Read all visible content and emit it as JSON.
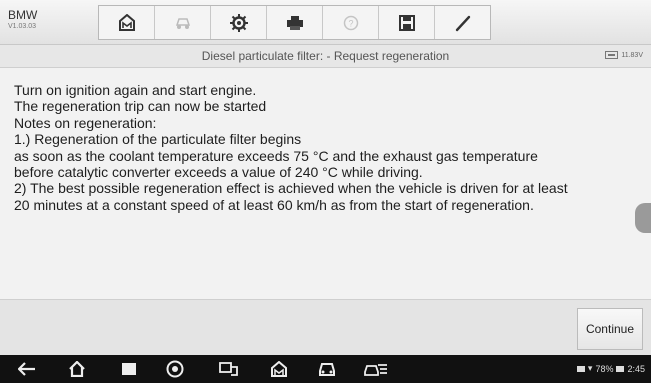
{
  "app": {
    "brand": "BMW",
    "version": "V1.03.03"
  },
  "toolbar": {
    "buttons": [
      {
        "icon": "home-icon"
      },
      {
        "icon": "car-icon"
      },
      {
        "icon": "gear-icon"
      },
      {
        "icon": "printer-icon"
      },
      {
        "icon": "help-icon"
      },
      {
        "icon": "save-icon"
      },
      {
        "icon": "pen-icon"
      }
    ]
  },
  "header": {
    "title": "Diesel particulate filter: - Request regeneration",
    "voltage": "11.83V"
  },
  "message": {
    "lines": [
      "Turn on ignition again and start engine.",
      "The regeneration trip can now be started",
      "Notes on regeneration:",
      "1.) Regeneration of the particulate filter begins",
      "as soon as the coolant temperature exceeds 75 °C and the exhaust gas temperature",
      "before catalytic converter exceeds a value of 240 °C while driving.",
      "2) The best possible regeneration effect is achieved when the vehicle is driven for at least",
      "20 minutes at a constant speed of at least 60 km/h as from the start of regeneration."
    ]
  },
  "footer": {
    "continue_label": "Continue"
  },
  "system_bar": {
    "battery_percent": "78%",
    "time": "2:45",
    "icons": [
      "back-icon",
      "home-icon",
      "recent-apps-icon",
      "browser-icon",
      "vci-icon",
      "garage-icon",
      "car-icon",
      "vehicle-menu-icon"
    ]
  },
  "colors": {
    "background": "#f2f2f2",
    "navbar": "#111111",
    "text": "#1e1e1e"
  }
}
